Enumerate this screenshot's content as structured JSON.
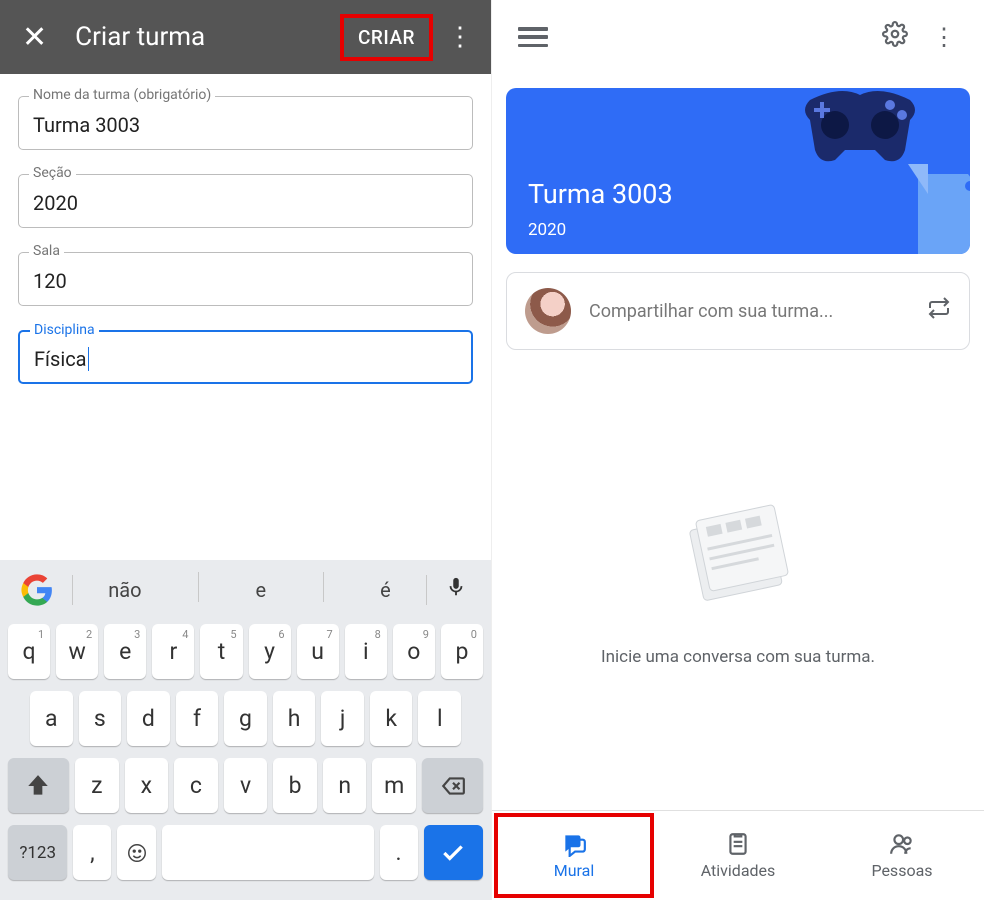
{
  "left": {
    "topbar": {
      "title": "Criar turma",
      "create_label": "CRIAR"
    },
    "fields": {
      "nome": {
        "label": "Nome da turma (obrigatório)",
        "value": "Turma 3003"
      },
      "secao": {
        "label": "Seção",
        "value": "2020"
      },
      "sala": {
        "label": "Sala",
        "value": "120"
      },
      "disciplina": {
        "label": "Disciplina",
        "value": "Física"
      }
    },
    "keyboard": {
      "suggestions": [
        "não",
        "e",
        "é"
      ],
      "row1": [
        "q",
        "w",
        "e",
        "r",
        "t",
        "y",
        "u",
        "i",
        "o",
        "p"
      ],
      "row1_sup": [
        "1",
        "2",
        "3",
        "4",
        "5",
        "6",
        "7",
        "8",
        "9",
        "0"
      ],
      "row2": [
        "a",
        "s",
        "d",
        "f",
        "g",
        "h",
        "j",
        "k",
        "l"
      ],
      "row3": [
        "z",
        "x",
        "c",
        "v",
        "b",
        "n",
        "m"
      ],
      "bottom": {
        "sym": "?123",
        "comma": ",",
        "period": "."
      }
    }
  },
  "right": {
    "banner": {
      "title": "Turma 3003",
      "section": "2020"
    },
    "share": {
      "placeholder": "Compartilhar com sua turma..."
    },
    "empty": {
      "message": "Inicie uma conversa com sua turma."
    },
    "tabs": {
      "mural": "Mural",
      "atividades": "Atividades",
      "pessoas": "Pessoas"
    }
  }
}
